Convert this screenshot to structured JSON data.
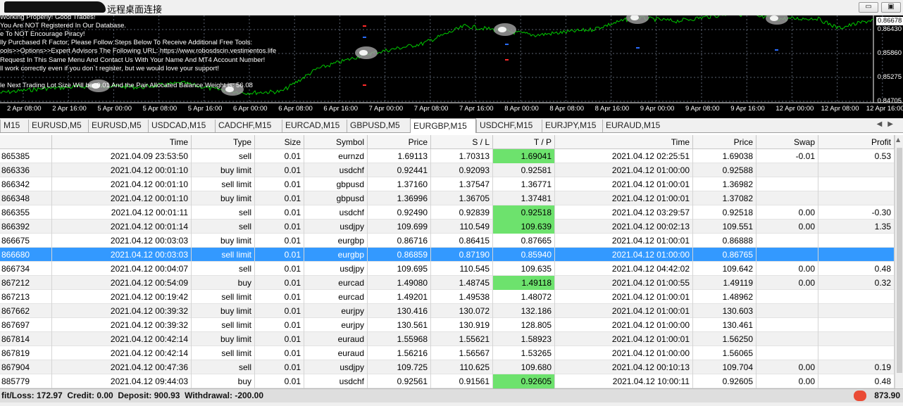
{
  "window": {
    "title": "远程桌面连接",
    "minimize_glyph": "▭",
    "restore_glyph": "▣"
  },
  "chart": {
    "ea_lines": [
      "Working Properly! Good Trades!",
      "You Are NOT Registered In Our Database.",
      "e To NOT Encourage Piracy!",
      "lly Purchased R Factor, Please Follow Steps Below To Receive Additional Free Tools:",
      "ools>>Options>>Expert Advisors The Following URL: https://www.robosdscin.vestimentos.life",
      "Request In This Same Menu And Contact Us With Your Name And MT4 Account Number!",
      "ll work correctly even if you don`t register, but we would love your support!",
      "",
      "le Next Trading Lot Size Will be: 0.01 And the Pair Allocated Balance Weight is: 56.08"
    ],
    "current_price": "0.86678",
    "price_labels": [
      "0.86430",
      "0.85860",
      "0.85275",
      "0.84705"
    ],
    "time_labels": [
      "2 Apr 08:00",
      "2 Apr 16:00",
      "5 Apr 00:00",
      "5 Apr 08:00",
      "5 Apr 16:00",
      "6 Apr 00:00",
      "6 Apr 08:00",
      "6 Apr 16:00",
      "7 Apr 00:00",
      "7 Apr 08:00",
      "7 Apr 16:00",
      "8 Apr 00:00",
      "8 Apr 08:00",
      "8 Apr 16:00",
      "9 Apr 00:00",
      "9 Apr 08:00",
      "9 Apr 16:00",
      "12 Apr 00:00",
      "12 Apr 08:00",
      "12 Apr 16:00"
    ],
    "line_color": "#00c800",
    "grid_color": "#5a6270"
  },
  "tabs": [
    {
      "label": "M15",
      "active": false
    },
    {
      "label": "EURUSD,M5",
      "active": false
    },
    {
      "label": "EURUSD,M5",
      "active": false
    },
    {
      "label": "USDCAD,M15",
      "active": false
    },
    {
      "label": "CADCHF,M15",
      "active": false
    },
    {
      "label": "EURCAD,M15",
      "active": false
    },
    {
      "label": "GBPUSD,M5",
      "active": false
    },
    {
      "label": "EURGBP,M15",
      "active": true
    },
    {
      "label": "USDCHF,M15",
      "active": false
    },
    {
      "label": "EURJPY,M15",
      "active": false
    },
    {
      "label": "EURAUD,M15",
      "active": false
    }
  ],
  "tab_scroll_glyphs": "◀▶",
  "table": {
    "columns": [
      "",
      "Time",
      "Type",
      "Size",
      "Symbol",
      "Price",
      "S / L",
      "T / P",
      "Time",
      "Price",
      "Swap",
      "Profit"
    ],
    "rows": [
      {
        "id": "865385",
        "open_time": "2021.04.09 23:53:50",
        "type": "sell",
        "size": "0.01",
        "symbol": "eurnzd",
        "price": "1.69113",
        "sl": "1.70313",
        "tp": "1.69041",
        "close_time": "2021.04.12 02:25:51",
        "close_price": "1.69038",
        "swap": "-0.01",
        "profit": "0.53",
        "tp_hit": true
      },
      {
        "id": "866336",
        "open_time": "2021.04.12 00:01:10",
        "type": "buy limit",
        "size": "0.01",
        "symbol": "usdchf",
        "price": "0.92441",
        "sl": "0.92093",
        "tp": "0.92581",
        "close_time": "2021.04.12 01:00:00",
        "close_price": "0.92588",
        "swap": "",
        "profit": "",
        "tp_hit": false
      },
      {
        "id": "866342",
        "open_time": "2021.04.12 00:01:10",
        "type": "sell limit",
        "size": "0.01",
        "symbol": "gbpusd",
        "price": "1.37160",
        "sl": "1.37547",
        "tp": "1.36771",
        "close_time": "2021.04.12 01:00:01",
        "close_price": "1.36982",
        "swap": "",
        "profit": "",
        "tp_hit": false
      },
      {
        "id": "866348",
        "open_time": "2021.04.12 00:01:10",
        "type": "buy limit",
        "size": "0.01",
        "symbol": "gbpusd",
        "price": "1.36996",
        "sl": "1.36705",
        "tp": "1.37481",
        "close_time": "2021.04.12 01:00:01",
        "close_price": "1.37082",
        "swap": "",
        "profit": "",
        "tp_hit": false
      },
      {
        "id": "866355",
        "open_time": "2021.04.12 00:01:11",
        "type": "sell",
        "size": "0.01",
        "symbol": "usdchf",
        "price": "0.92490",
        "sl": "0.92839",
        "tp": "0.92518",
        "close_time": "2021.04.12 03:29:57",
        "close_price": "0.92518",
        "swap": "0.00",
        "profit": "-0.30",
        "tp_hit": true
      },
      {
        "id": "866392",
        "open_time": "2021.04.12 00:01:14",
        "type": "sell",
        "size": "0.01",
        "symbol": "usdjpy",
        "price": "109.699",
        "sl": "110.549",
        "tp": "109.639",
        "close_time": "2021.04.12 00:02:13",
        "close_price": "109.551",
        "swap": "0.00",
        "profit": "1.35",
        "tp_hit": true
      },
      {
        "id": "866675",
        "open_time": "2021.04.12 00:03:03",
        "type": "buy limit",
        "size": "0.01",
        "symbol": "eurgbp",
        "price": "0.86716",
        "sl": "0.86415",
        "tp": "0.87665",
        "close_time": "2021.04.12 01:00:01",
        "close_price": "0.86888",
        "swap": "",
        "profit": "",
        "tp_hit": false
      },
      {
        "id": "866680",
        "open_time": "2021.04.12 00:03:03",
        "type": "sell limit",
        "size": "0.01",
        "symbol": "eurgbp",
        "price": "0.86859",
        "sl": "0.87190",
        "tp": "0.85940",
        "close_time": "2021.04.12 01:00:00",
        "close_price": "0.86765",
        "swap": "",
        "profit": "",
        "tp_hit": false,
        "selected": true
      },
      {
        "id": "866734",
        "open_time": "2021.04.12 00:04:07",
        "type": "sell",
        "size": "0.01",
        "symbol": "usdjpy",
        "price": "109.695",
        "sl": "110.545",
        "tp": "109.635",
        "close_time": "2021.04.12 04:42:02",
        "close_price": "109.642",
        "swap": "0.00",
        "profit": "0.48",
        "tp_hit": false
      },
      {
        "id": "867212",
        "open_time": "2021.04.12 00:54:09",
        "type": "buy",
        "size": "0.01",
        "symbol": "eurcad",
        "price": "1.49080",
        "sl": "1.48745",
        "tp": "1.49118",
        "close_time": "2021.04.12 01:00:55",
        "close_price": "1.49119",
        "swap": "0.00",
        "profit": "0.32",
        "tp_hit": true
      },
      {
        "id": "867213",
        "open_time": "2021.04.12 00:19:42",
        "type": "sell limit",
        "size": "0.01",
        "symbol": "eurcad",
        "price": "1.49201",
        "sl": "1.49538",
        "tp": "1.48072",
        "close_time": "2021.04.12 01:00:01",
        "close_price": "1.48962",
        "swap": "",
        "profit": "",
        "tp_hit": false
      },
      {
        "id": "867662",
        "open_time": "2021.04.12 00:39:32",
        "type": "buy limit",
        "size": "0.01",
        "symbol": "eurjpy",
        "price": "130.416",
        "sl": "130.072",
        "tp": "132.186",
        "close_time": "2021.04.12 01:00:01",
        "close_price": "130.603",
        "swap": "",
        "profit": "",
        "tp_hit": false
      },
      {
        "id": "867697",
        "open_time": "2021.04.12 00:39:32",
        "type": "sell limit",
        "size": "0.01",
        "symbol": "eurjpy",
        "price": "130.561",
        "sl": "130.919",
        "tp": "128.805",
        "close_time": "2021.04.12 01:00:00",
        "close_price": "130.461",
        "swap": "",
        "profit": "",
        "tp_hit": false
      },
      {
        "id": "867814",
        "open_time": "2021.04.12 00:42:14",
        "type": "buy limit",
        "size": "0.01",
        "symbol": "euraud",
        "price": "1.55968",
        "sl": "1.55621",
        "tp": "1.58923",
        "close_time": "2021.04.12 01:00:01",
        "close_price": "1.56250",
        "swap": "",
        "profit": "",
        "tp_hit": false
      },
      {
        "id": "867819",
        "open_time": "2021.04.12 00:42:14",
        "type": "sell limit",
        "size": "0.01",
        "symbol": "euraud",
        "price": "1.56216",
        "sl": "1.56567",
        "tp": "1.53265",
        "close_time": "2021.04.12 01:00:00",
        "close_price": "1.56065",
        "swap": "",
        "profit": "",
        "tp_hit": false
      },
      {
        "id": "867904",
        "open_time": "2021.04.12 00:47:36",
        "type": "sell",
        "size": "0.01",
        "symbol": "usdjpy",
        "price": "109.725",
        "sl": "110.625",
        "tp": "109.680",
        "close_time": "2021.04.12 00:10:13",
        "close_price": "109.704",
        "swap": "0.00",
        "profit": "0.19",
        "tp_hit": false
      },
      {
        "id": "885779",
        "open_time": "2021.04.12 09:44:03",
        "type": "buy",
        "size": "0.01",
        "symbol": "usdchf",
        "price": "0.92561",
        "sl": "0.91561",
        "tp": "0.92605",
        "close_time": "2021.04.12 10:00:11",
        "close_price": "0.92605",
        "swap": "0.00",
        "profit": "0.48",
        "tp_hit": true
      }
    ]
  },
  "status": {
    "summary": "fit/Loss: 172.97  Credit: 0.00  Deposit: 900.93  Withdrawal: -200.00",
    "total": "873.90"
  },
  "scroll_up_glyph": "▲"
}
